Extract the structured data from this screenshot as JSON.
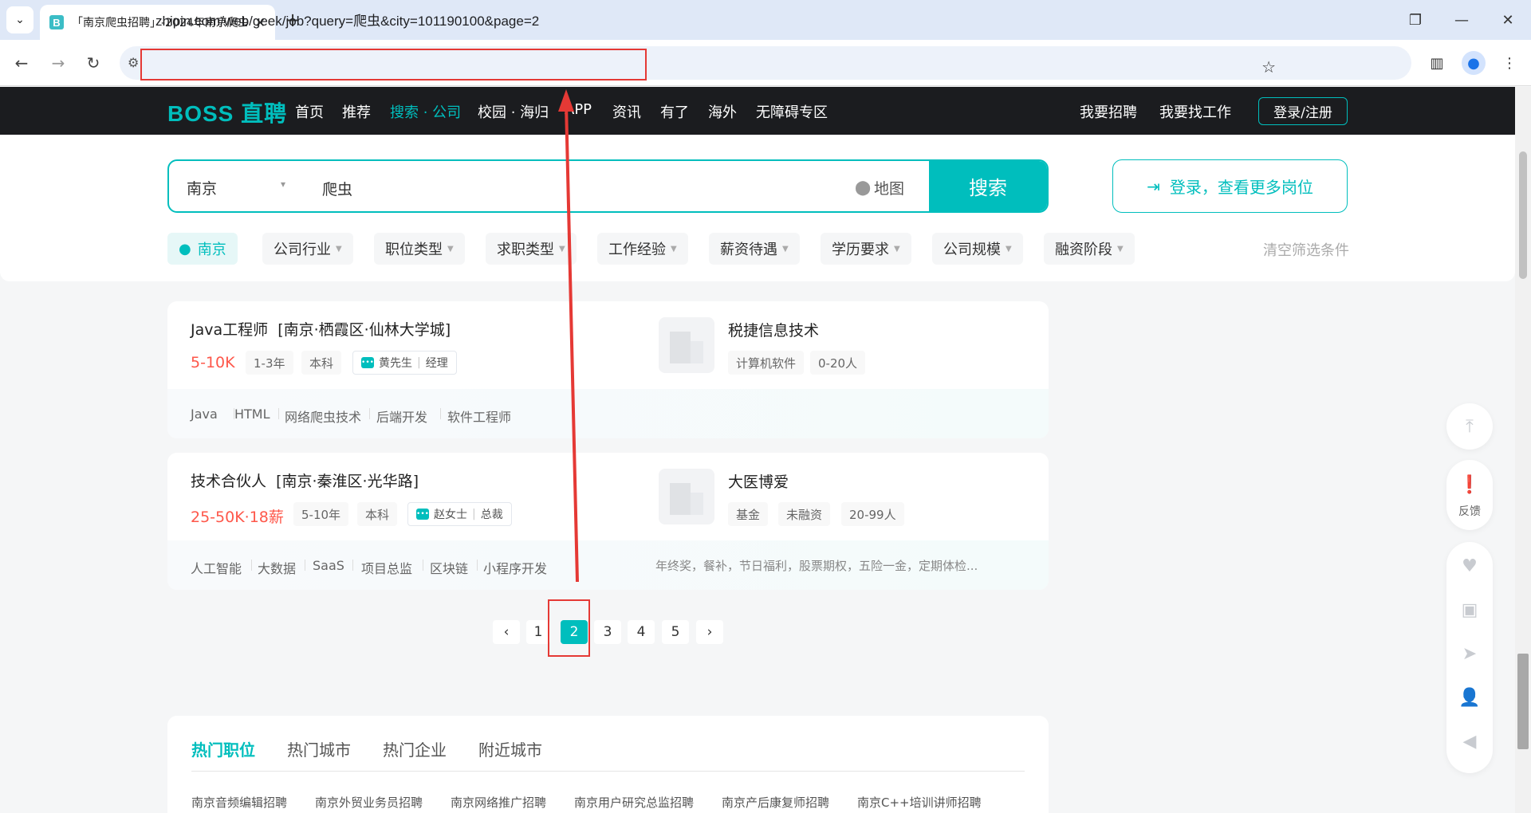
{
  "browser": {
    "tab_title": "「南京爬虫招聘」-2024年南京爬虫人才招聘",
    "url": "zhipin.com/web/geek/job?query=爬虫&city=101190100&page=2",
    "favicon_letter": "B"
  },
  "header": {
    "logo": "BOSS 直聘",
    "nav": [
      "首页",
      "推荐",
      "搜索 · 公司",
      "校园 · 海归",
      "APP",
      "资讯",
      "有了",
      "海外",
      "无障碍专区"
    ],
    "active_nav": "搜索 · 公司",
    "recruit": "我要招聘",
    "find_job": "我要找工作",
    "login": "登录/注册"
  },
  "search": {
    "city": "南京",
    "query": "爬虫",
    "map_label": "地图",
    "button": "搜索",
    "login_more": "登录，查看更多岗位"
  },
  "filters": {
    "city": "南京",
    "items": [
      "公司行业",
      "职位类型",
      "求职类型",
      "工作经验",
      "薪资待遇",
      "学历要求",
      "公司规模",
      "融资阶段"
    ],
    "clear": "清空筛选条件"
  },
  "jobs": [
    {
      "title": "Java工程师",
      "location": "[南京·栖霞区·仙林大学城]",
      "salary": "5-10K",
      "tags": [
        "1-3年",
        "本科"
      ],
      "recruiter": "黄先生",
      "recruiter_role": "经理",
      "company": "税捷信息技术",
      "company_tags": [
        "计算机软件",
        "0-20人"
      ],
      "skills": [
        "Java",
        "HTML",
        "网络爬虫技术",
        "后端开发",
        "软件工程师"
      ],
      "welfare": ""
    },
    {
      "title": "技术合伙人",
      "location": "[南京·秦淮区·光华路]",
      "salary": "25-50K·18薪",
      "tags": [
        "5-10年",
        "本科"
      ],
      "recruiter": "赵女士",
      "recruiter_role": "总裁",
      "company": "大医博爱",
      "company_tags": [
        "基金",
        "未融资",
        "20-99人"
      ],
      "skills": [
        "人工智能",
        "大数据",
        "SaaS",
        "项目总监",
        "区块链",
        "小程序开发"
      ],
      "welfare": "年终奖，餐补，节日福利，股票期权，五险一金，定期体检..."
    }
  ],
  "pagination": {
    "prev": "‹",
    "next": "›",
    "pages": [
      "1",
      "2",
      "3",
      "4",
      "5"
    ],
    "current": "2"
  },
  "hot": {
    "tabs": [
      "热门职位",
      "热门城市",
      "热门企业",
      "附近城市"
    ],
    "links": [
      "南京音频编辑招聘",
      "南京外贸业务员招聘",
      "南京网络推广招聘",
      "南京用户研究总监招聘",
      "南京产后康复师招聘",
      "南京C++培训讲师招聘"
    ]
  },
  "sidebar": {
    "feedback": "反馈"
  },
  "colors": {
    "brand": "#00bebd",
    "salary": "#fe574a",
    "annotation": "#e53935"
  }
}
